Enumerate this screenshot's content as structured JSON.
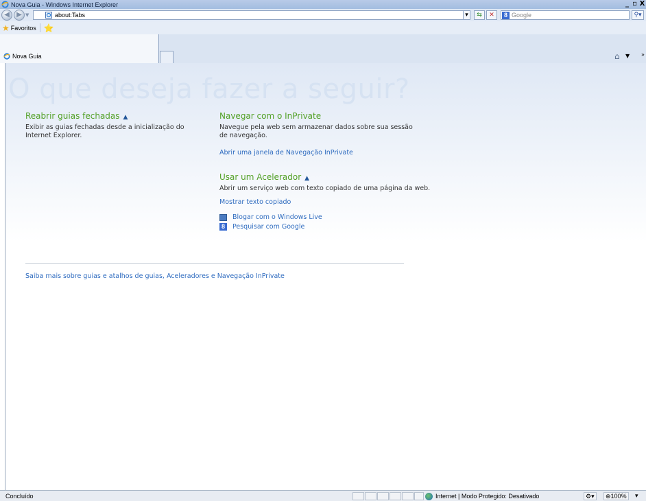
{
  "window": {
    "title": "Nova Guia - Windows Internet Explorer",
    "controls": {
      "minimize": "_",
      "maximize": "▫",
      "close": "X"
    }
  },
  "navbar": {
    "back_icon": "back-arrow-icon",
    "forward_icon": "forward-arrow-icon",
    "address_value": "about:Tabs",
    "search_placeholder": "Google",
    "search_provider_letter": "8"
  },
  "favorites_bar": {
    "favorites_label": "Favoritos"
  },
  "tabs": [
    {
      "label": "Nova Guia",
      "active": true
    }
  ],
  "page": {
    "headline": "O que deseja fazer a seguir?",
    "reopen": {
      "title": "Reabrir guias fechadas",
      "chevron": "▲",
      "text": "Exibir as guias fechadas desde a inicialização do Internet Explorer."
    },
    "inprivate": {
      "title": "Navegar com o InPrivate",
      "text": "Navegue pela web sem armazenar dados sobre sua sessão de navegação.",
      "link": "Abrir uma janela de Navegação InPrivate"
    },
    "accelerator": {
      "title": "Usar um Acelerador",
      "chevron": "▲",
      "text": "Abrir um serviço web com texto copiado de uma página da web.",
      "show_link": "Mostrar texto copiado",
      "items": [
        {
          "label": "Blogar com o Windows Live",
          "icon": "windows-live-blog-icon"
        },
        {
          "label": "Pesquisar com Google",
          "icon": "google-icon"
        }
      ]
    },
    "footer_link": "Saiba mais sobre guias e atalhos de guias, Aceleradores e Navegação InPrivate"
  },
  "statusbar": {
    "status": "Concluído",
    "zone": "Internet | Modo Protegido: Desativado",
    "zoom": "100%",
    "zoom_prefix": "⊕",
    "dropdown_glyph": "▾"
  }
}
